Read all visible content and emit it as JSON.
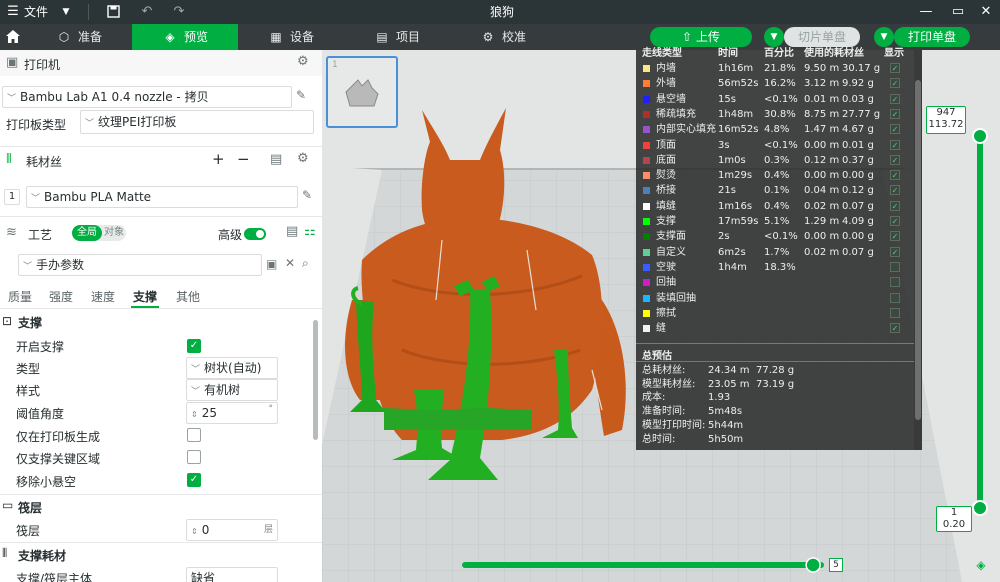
{
  "titlebar": {
    "menu_label": "文件",
    "app_title": "狼狗"
  },
  "tabs": [
    {
      "label": "准备"
    },
    {
      "label": "预览"
    },
    {
      "label": "设备"
    },
    {
      "label": "项目"
    },
    {
      "label": "校准"
    }
  ],
  "actions": {
    "upload": "上传",
    "slice": "切片单盘",
    "print": "打印单盘"
  },
  "printer": {
    "section_title": "打印机",
    "printer_name": "Bambu Lab A1 0.4 nozzle - 拷贝",
    "plate_type_label": "打印板类型",
    "plate_type_value": "纹理PEI打印板"
  },
  "filament": {
    "section_title": "耗材丝",
    "slot_number": "1",
    "name": "Bambu PLA Matte"
  },
  "process": {
    "section_title": "工艺",
    "global_label": "全局",
    "object_label": "对象",
    "advanced_label": "高级",
    "preset": "手办参数",
    "subtabs": [
      "质量",
      "强度",
      "速度",
      "支撑",
      "其他"
    ],
    "active_subtab": "支撑"
  },
  "support": {
    "group_title": "支撑",
    "enable_label": "开启支撑",
    "type_label": "类型",
    "type_value": "树状(自动)",
    "style_label": "样式",
    "style_value": "有机树",
    "threshold_label": "阈值角度",
    "threshold_value": "25",
    "threshold_unit": "°",
    "buildplate_label": "仅在打印板生成",
    "critical_label": "仅支撑关键区域",
    "remove_small_label": "移除小悬空"
  },
  "raft": {
    "group_title": "筏层",
    "layers_label": "筏层",
    "layers_value": "0",
    "layers_unit": "层"
  },
  "support_filament": {
    "group_title": "支撑耗材",
    "base_label": "支撑/筏层主体",
    "base_value": "缺省"
  },
  "plate_thumb": {
    "number": "1"
  },
  "legend": {
    "headers": [
      "走线类型",
      "时间",
      "百分比",
      "使用的耗材丝",
      "显示"
    ],
    "rows": [
      {
        "name": "内墙",
        "color": "#ffe680",
        "time": "1h16m",
        "pct": "21.8%",
        "len": "9.50 m",
        "weight": "30.17 g",
        "shown": true
      },
      {
        "name": "外墙",
        "color": "#ff7d38",
        "time": "56m52s",
        "pct": "16.2%",
        "len": "3.12 m",
        "weight": "9.92 g",
        "shown": true
      },
      {
        "name": "悬空墙",
        "color": "#1f1fff",
        "time": "15s",
        "pct": "<0.1%",
        "len": "0.01 m",
        "weight": "0.03 g",
        "shown": true
      },
      {
        "name": "稀疏填充",
        "color": "#b03029",
        "time": "1h48m",
        "pct": "30.8%",
        "len": "8.75 m",
        "weight": "27.77 g",
        "shown": true
      },
      {
        "name": "内部实心填充",
        "color": "#9654cc",
        "time": "16m52s",
        "pct": "4.8%",
        "len": "1.47 m",
        "weight": "4.67 g",
        "shown": true
      },
      {
        "name": "顶面",
        "color": "#f04040",
        "time": "3s",
        "pct": "<0.1%",
        "len": "0.00 m",
        "weight": "0.01 g",
        "shown": true
      },
      {
        "name": "底面",
        "color": "#b3464d",
        "time": "1m0s",
        "pct": "0.3%",
        "len": "0.12 m",
        "weight": "0.37 g",
        "shown": true
      },
      {
        "name": "熨烫",
        "color": "#ff8c69",
        "time": "1m29s",
        "pct": "0.4%",
        "len": "0.00 m",
        "weight": "0.00 g",
        "shown": true
      },
      {
        "name": "桥接",
        "color": "#4d80ba",
        "time": "21s",
        "pct": "0.1%",
        "len": "0.04 m",
        "weight": "0.12 g",
        "shown": true
      },
      {
        "name": "填缝",
        "color": "#ffffff",
        "time": "1m16s",
        "pct": "0.4%",
        "len": "0.02 m",
        "weight": "0.07 g",
        "shown": true
      },
      {
        "name": "支撑",
        "color": "#00ff00",
        "time": "17m59s",
        "pct": "5.1%",
        "len": "1.29 m",
        "weight": "4.09 g",
        "shown": true
      },
      {
        "name": "支撑面",
        "color": "#008000",
        "time": "2s",
        "pct": "<0.1%",
        "len": "0.00 m",
        "weight": "0.00 g",
        "shown": true
      },
      {
        "name": "自定义",
        "color": "#5ed194",
        "time": "6m2s",
        "pct": "1.7%",
        "len": "0.02 m",
        "weight": "0.07 g",
        "shown": true
      },
      {
        "name": "空驶",
        "color": "#385cff",
        "time": "1h4m",
        "pct": "18.3%",
        "len": "",
        "weight": "",
        "shown": false
      },
      {
        "name": "回抽",
        "color": "#cc1ccc",
        "time": "",
        "pct": "",
        "len": "",
        "weight": "",
        "shown": false
      },
      {
        "name": "装填回抽",
        "color": "#1cb3ff",
        "time": "",
        "pct": "",
        "len": "",
        "weight": "",
        "shown": false
      },
      {
        "name": "擦拭",
        "color": "#ffff00",
        "time": "",
        "pct": "",
        "len": "",
        "weight": "",
        "shown": false
      },
      {
        "name": "缝",
        "color": "#f2f2f2",
        "time": "",
        "pct": "",
        "len": "",
        "weight": "",
        "shown": true
      }
    ],
    "estimate_title": "总预估",
    "estimates": [
      {
        "label": "总耗材丝:",
        "v1": "24.34 m",
        "v2": "77.28 g"
      },
      {
        "label": "模型耗材丝:",
        "v1": "23.05 m",
        "v2": "73.19 g"
      },
      {
        "label": "成本:",
        "v1": "1.93",
        "v2": ""
      },
      {
        "label": "准备时间:",
        "v1": "5m48s",
        "v2": ""
      },
      {
        "label": "模型打印时间:",
        "v1": "5h44m",
        "v2": ""
      },
      {
        "label": "总时间:",
        "v1": "5h50m",
        "v2": ""
      }
    ]
  },
  "layer_slider": {
    "top_layer": "947",
    "top_height": "113.72",
    "bottom_layer": "1",
    "bottom_height": "0.20",
    "top_fraction": 1.0,
    "bottom_fraction": 0.0
  },
  "move_slider": {
    "value": "5",
    "fraction": 0.97
  }
}
